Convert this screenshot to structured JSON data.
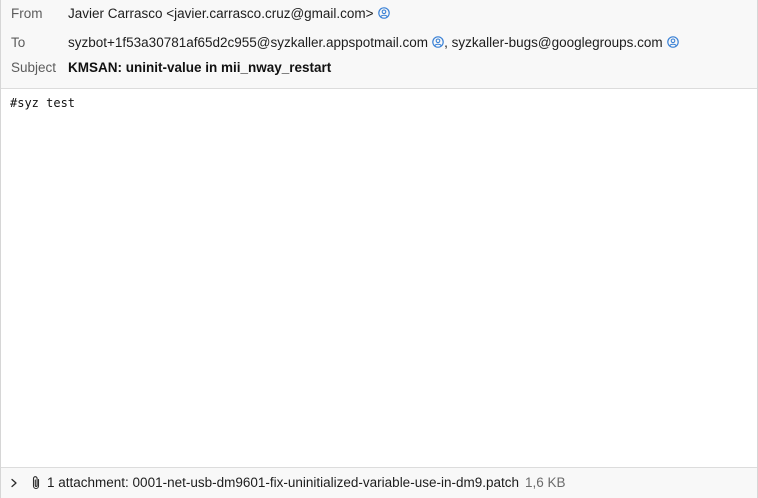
{
  "header": {
    "from_label": "From",
    "from_value": "Javier Carrasco <javier.carrasco.cruz@gmail.com>",
    "to_label": "To",
    "to_recipients": [
      "syzbot+1f53a30781af65d2c955@syzkaller.appspotmail.com",
      "syzkaller-bugs@googlegroups.com"
    ],
    "to_separator": ",",
    "subject_label": "Subject",
    "subject_value": "KMSAN: uninit-value in mii_nway_restart"
  },
  "body": {
    "text": "#syz test"
  },
  "attachments": {
    "summary": "1 attachment: 0001-net-usb-dm9601-fix-uninitialized-variable-use-in-dm9.patch",
    "size": "1,6 KB"
  },
  "icons": {
    "contact": "contact-icon",
    "expand": "chevron-right-icon",
    "attachment": "paperclip-icon"
  },
  "colors": {
    "header_bg": "#f8f8f8",
    "contact_icon": "#3b82d6",
    "label_gray": "#5c5c5c"
  }
}
